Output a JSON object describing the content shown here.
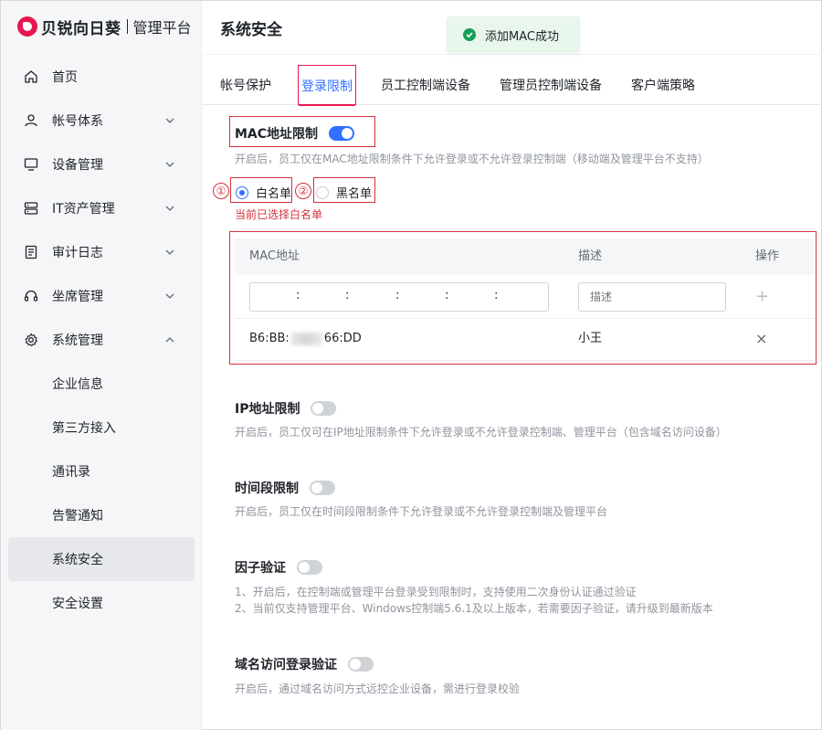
{
  "app": {
    "brand": "贝锐向日葵",
    "sub": "管理平台"
  },
  "sidebar": {
    "items": [
      {
        "label": "首页",
        "icon": "home-icon",
        "chev": ""
      },
      {
        "label": "帐号体系",
        "icon": "user-icon",
        "chev": "down"
      },
      {
        "label": "设备管理",
        "icon": "monitor-icon",
        "chev": "down"
      },
      {
        "label": "IT资产管理",
        "icon": "server-icon",
        "chev": "down"
      },
      {
        "label": "审计日志",
        "icon": "document-icon",
        "chev": "down"
      },
      {
        "label": "坐席管理",
        "icon": "headset-icon",
        "chev": "down"
      },
      {
        "label": "系统管理",
        "icon": "gear-icon",
        "chev": "up"
      }
    ],
    "sub_items": [
      "企业信息",
      "第三方接入",
      "通讯录",
      "告警通知",
      "系统安全",
      "安全设置"
    ],
    "active_sub": "系统安全"
  },
  "header": {
    "title": "系统安全"
  },
  "toast": {
    "text": "添加MAC成功"
  },
  "tabs": [
    "帐号保护",
    "登录限制",
    "员工控制端设备",
    "管理员控制端设备",
    "客户端策略"
  ],
  "mac": {
    "title": "MAC地址限制",
    "enabled": true,
    "desc": "开启后，员工仅在MAC地址限制条件下允许登录或不允许登录控制端（移动端及管理平台不支持）",
    "whitelist": "白名单",
    "blacklist": "黑名单",
    "mark1": "①",
    "mark2": "②",
    "selected_note": "当前已选择白名单",
    "table": {
      "col_mac": "MAC地址",
      "col_desc": "描述",
      "col_op": "操作",
      "desc_placeholder": "描述",
      "add_icon": "+",
      "row": {
        "mac_prefix": "B6:BB:",
        "mac_suffix": "66:DD",
        "desc": "小王",
        "delete_icon": "×"
      },
      "sep": ":"
    }
  },
  "ip": {
    "title": "IP地址限制",
    "enabled": false,
    "desc": "开启后，员工仅可在IP地址限制条件下允许登录或不允许登录控制端、管理平台（包含域名访问设备）"
  },
  "time": {
    "title": "时间段限制",
    "enabled": false,
    "desc": "开启后，员工仅在时间段限制条件下允许登录或不允许登录控制端及管理平台"
  },
  "factor": {
    "title": "因子验证",
    "enabled": false,
    "desc1": "1、开启后，在控制端或管理平台登录受到限制时，支持使用二次身份认证通过验证",
    "desc2": "2、当前仅支持管理平台、Windows控制端5.6.1及以上版本，若需要因子验证，请升级到最新版本"
  },
  "domain": {
    "title": "域名访问登录验证",
    "enabled": false,
    "desc": "开启后，通过域名访问方式远控企业设备，需进行登录校验"
  }
}
